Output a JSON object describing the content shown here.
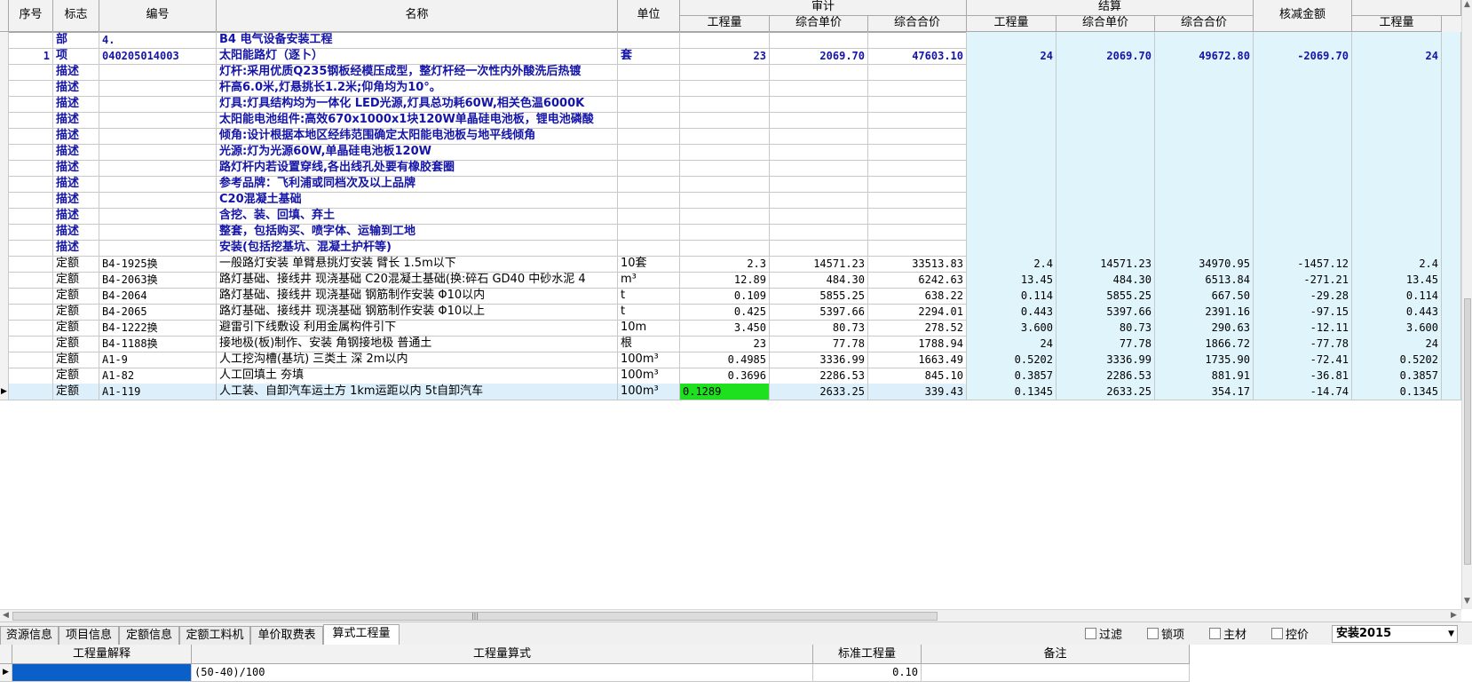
{
  "header": {
    "group_shenji": "审计",
    "group_jiesuan": "结算",
    "cols": {
      "seq": "序号",
      "flag": "标志",
      "code": "编号",
      "name": "名称",
      "unit": "单位",
      "qty1": "工程量",
      "price1": "综合单价",
      "total1": "综合合价",
      "qty2": "工程量",
      "price2": "综合单价",
      "total2": "综合合价",
      "reduce": "核减金额",
      "qty3": "工程量"
    }
  },
  "rows": [
    {
      "seq": "",
      "flag": "部",
      "code": "4.",
      "name": "B4 电气设备安装工程",
      "unit": "",
      "q1": "",
      "p1": "",
      "t1": "",
      "q2": "",
      "p2": "",
      "t2": "",
      "r": "",
      "q3": "",
      "style": "part"
    },
    {
      "seq": "1",
      "flag": "项",
      "code": "040205014003",
      "name": "太阳能路灯（逐卜）",
      "unit": "套",
      "q1": "23",
      "p1": "2069.70",
      "t1": "47603.10",
      "q2": "24",
      "p2": "2069.70",
      "t2": "49672.80",
      "r": "-2069.70",
      "q3": "24",
      "style": "item"
    },
    {
      "seq": "",
      "flag": "描述",
      "code": "",
      "name": "灯杆:采用优质Q235钢板经模压成型，整灯杆经一次性内外酸洗后热镀",
      "unit": "",
      "q1": "",
      "p1": "",
      "t1": "",
      "q2": "",
      "p2": "",
      "t2": "",
      "r": "",
      "q3": "",
      "style": "desc"
    },
    {
      "seq": "",
      "flag": "描述",
      "code": "",
      "name": "杆高6.0米,灯悬挑长1.2米;仰角均为10°。",
      "unit": "",
      "q1": "",
      "p1": "",
      "t1": "",
      "q2": "",
      "p2": "",
      "t2": "",
      "r": "",
      "q3": "",
      "style": "desc"
    },
    {
      "seq": "",
      "flag": "描述",
      "code": "",
      "name": "灯具:灯具结构均为一体化 LED光源,灯具总功耗60W,相关色温6000K",
      "unit": "",
      "q1": "",
      "p1": "",
      "t1": "",
      "q2": "",
      "p2": "",
      "t2": "",
      "r": "",
      "q3": "",
      "style": "desc"
    },
    {
      "seq": "",
      "flag": "描述",
      "code": "",
      "name": "太阳能电池组件:高效670x1000x1块120W单晶硅电池板，锂电池磷酸",
      "unit": "",
      "q1": "",
      "p1": "",
      "t1": "",
      "q2": "",
      "p2": "",
      "t2": "",
      "r": "",
      "q3": "",
      "style": "desc"
    },
    {
      "seq": "",
      "flag": "描述",
      "code": "",
      "name": "倾角:设计根据本地区经纬范围确定太阳能电池板与地平线倾角",
      "unit": "",
      "q1": "",
      "p1": "",
      "t1": "",
      "q2": "",
      "p2": "",
      "t2": "",
      "r": "",
      "q3": "",
      "style": "desc"
    },
    {
      "seq": "",
      "flag": "描述",
      "code": "",
      "name": "光源:灯为光源60W,单晶硅电池板120W",
      "unit": "",
      "q1": "",
      "p1": "",
      "t1": "",
      "q2": "",
      "p2": "",
      "t2": "",
      "r": "",
      "q3": "",
      "style": "desc"
    },
    {
      "seq": "",
      "flag": "描述",
      "code": "",
      "name": "路灯杆内若设置穿线,各出线孔处要有橡胶套圈",
      "unit": "",
      "q1": "",
      "p1": "",
      "t1": "",
      "q2": "",
      "p2": "",
      "t2": "",
      "r": "",
      "q3": "",
      "style": "desc"
    },
    {
      "seq": "",
      "flag": "描述",
      "code": "",
      "name": "参考品牌：飞利浦或同档次及以上品牌",
      "unit": "",
      "q1": "",
      "p1": "",
      "t1": "",
      "q2": "",
      "p2": "",
      "t2": "",
      "r": "",
      "q3": "",
      "style": "desc"
    },
    {
      "seq": "",
      "flag": "描述",
      "code": "",
      "name": "C20混凝土基础",
      "unit": "",
      "q1": "",
      "p1": "",
      "t1": "",
      "q2": "",
      "p2": "",
      "t2": "",
      "r": "",
      "q3": "",
      "style": "desc"
    },
    {
      "seq": "",
      "flag": "描述",
      "code": "",
      "name": "含挖、装、回填、弃土",
      "unit": "",
      "q1": "",
      "p1": "",
      "t1": "",
      "q2": "",
      "p2": "",
      "t2": "",
      "r": "",
      "q3": "",
      "style": "desc"
    },
    {
      "seq": "",
      "flag": "描述",
      "code": "",
      "name": "整套，包括购买、喷字体、运输到工地",
      "unit": "",
      "q1": "",
      "p1": "",
      "t1": "",
      "q2": "",
      "p2": "",
      "t2": "",
      "r": "",
      "q3": "",
      "style": "desc"
    },
    {
      "seq": "",
      "flag": "描述",
      "code": "",
      "name": "安装(包括挖基坑、混凝土护杆等)",
      "unit": "",
      "q1": "",
      "p1": "",
      "t1": "",
      "q2": "",
      "p2": "",
      "t2": "",
      "r": "",
      "q3": "",
      "style": "desc"
    },
    {
      "seq": "",
      "flag": "定额",
      "code": "B4-1925换",
      "name": "一般路灯安装 单臂悬挑灯安装 臂长 1.5m以下",
      "unit": "10套",
      "q1": "2.3",
      "p1": "14571.23",
      "t1": "33513.83",
      "q2": "2.4",
      "p2": "14571.23",
      "t2": "34970.95",
      "r": "-1457.12",
      "q3": "2.4",
      "style": "quota"
    },
    {
      "seq": "",
      "flag": "定额",
      "code": "B4-2063换",
      "name": "路灯基础、接线井 现浇基础  C20混凝土基础(换:碎石 GD40 中砂水泥 4",
      "unit": "m³",
      "q1": "12.89",
      "p1": "484.30",
      "t1": "6242.63",
      "q2": "13.45",
      "p2": "484.30",
      "t2": "6513.84",
      "r": "-271.21",
      "q3": "13.45",
      "style": "quota"
    },
    {
      "seq": "",
      "flag": "定额",
      "code": "B4-2064",
      "name": "路灯基础、接线井 现浇基础  钢筋制作安装 Φ10以内",
      "unit": "t",
      "q1": "0.109",
      "p1": "5855.25",
      "t1": "638.22",
      "q2": "0.114",
      "p2": "5855.25",
      "t2": "667.50",
      "r": "-29.28",
      "q3": "0.114",
      "style": "quota"
    },
    {
      "seq": "",
      "flag": "定额",
      "code": "B4-2065",
      "name": "路灯基础、接线井 现浇基础  钢筋制作安装 Φ10以上",
      "unit": "t",
      "q1": "0.425",
      "p1": "5397.66",
      "t1": "2294.01",
      "q2": "0.443",
      "p2": "5397.66",
      "t2": "2391.16",
      "r": "-97.15",
      "q3": "0.443",
      "style": "quota"
    },
    {
      "seq": "",
      "flag": "定额",
      "code": "B4-1222换",
      "name": "避雷引下线敷设 利用金属构件引下",
      "unit": "10m",
      "q1": "3.450",
      "p1": "80.73",
      "t1": "278.52",
      "q2": "3.600",
      "p2": "80.73",
      "t2": "290.63",
      "r": "-12.11",
      "q3": "3.600",
      "style": "quota"
    },
    {
      "seq": "",
      "flag": "定额",
      "code": "B4-1188换",
      "name": "接地极(板)制作、安装 角钢接地极 普通土",
      "unit": "根",
      "q1": "23",
      "p1": "77.78",
      "t1": "1788.94",
      "q2": "24",
      "p2": "77.78",
      "t2": "1866.72",
      "r": "-77.78",
      "q3": "24",
      "style": "quota"
    },
    {
      "seq": "",
      "flag": "定额",
      "code": "A1-9",
      "name": "人工挖沟槽(基坑) 三类土 深 2m以内",
      "unit": "100m³",
      "q1": "0.4985",
      "p1": "3336.99",
      "t1": "1663.49",
      "q2": "0.5202",
      "p2": "3336.99",
      "t2": "1735.90",
      "r": "-72.41",
      "q3": "0.5202",
      "style": "quota"
    },
    {
      "seq": "",
      "flag": "定额",
      "code": "A1-82",
      "name": "人工回填土 夯填",
      "unit": "100m³",
      "q1": "0.3696",
      "p1": "2286.53",
      "t1": "845.10",
      "q2": "0.3857",
      "p2": "2286.53",
      "t2": "881.91",
      "r": "-36.81",
      "q3": "0.3857",
      "style": "quota"
    },
    {
      "seq": "",
      "flag": "定额",
      "code": "A1-119",
      "name": "人工装、自卸汽车运土方 1km运距以内 5t自卸汽车",
      "unit": "100m³",
      "q1": "0.1289",
      "p1": "2633.25",
      "t1": "339.43",
      "q2": "0.1345",
      "p2": "2633.25",
      "t2": "354.17",
      "r": "-14.74",
      "q3": "0.1345",
      "style": "selected"
    }
  ],
  "tabs": [
    "资源信息",
    "项目信息",
    "定额信息",
    "定额工料机",
    "单价取费表",
    "算式工程量"
  ],
  "active_tab": "算式工程量",
  "options": [
    "过滤",
    "锁项",
    "主材",
    "控价"
  ],
  "standard_select": "安装2015",
  "sub_header": {
    "explain": "工程量解释",
    "formula": "工程量算式",
    "std_qty": "标准工程量",
    "note": "备注"
  },
  "sub_row": {
    "explain": "",
    "formula": "(50-40)/100",
    "std_qty": "0.10",
    "note": ""
  },
  "colors": {
    "light_blue": "#dff4fb",
    "bold_blue": "#1414a8",
    "green_edit": "#1ee01e",
    "selection_blue": "#0a5fc8"
  }
}
